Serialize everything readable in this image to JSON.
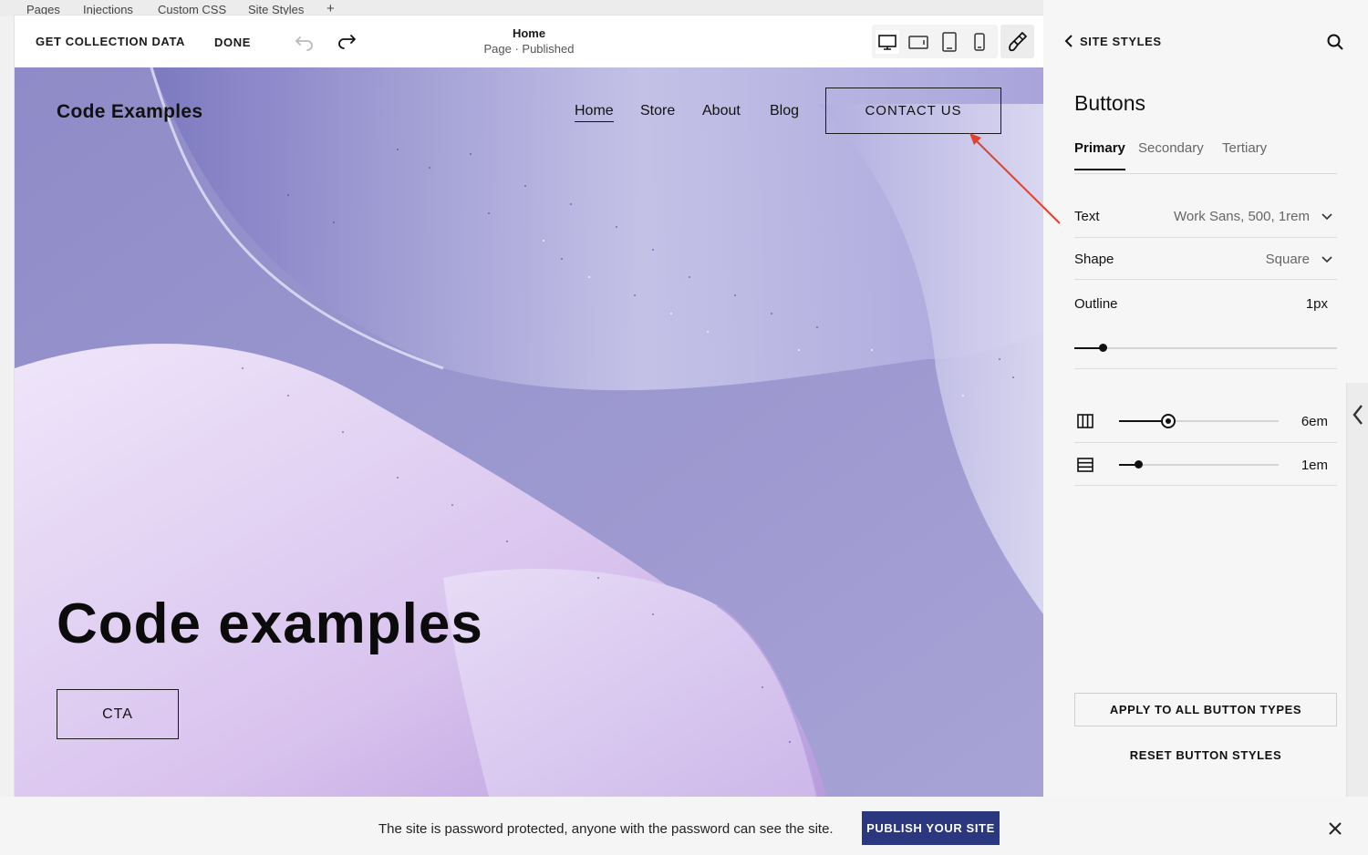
{
  "top_tabs": [
    "Pages",
    "Injections",
    "Custom CSS",
    "Site Styles",
    "+"
  ],
  "toolbar": {
    "get_collection": "GET COLLECTION DATA",
    "done": "DONE",
    "page_name": "Home",
    "page_status": "Page · Published"
  },
  "site": {
    "title": "Code Examples",
    "nav": [
      "Home",
      "Store",
      "About",
      "Blog"
    ],
    "contact": "CONTACT US",
    "hero": "Code examples",
    "cta": "CTA"
  },
  "panel": {
    "back_label": "SITE STYLES",
    "title": "Buttons",
    "tabs": [
      "Primary",
      "Secondary",
      "Tertiary"
    ],
    "text_label": "Text",
    "text_value": "Work Sans, 500, 1rem",
    "shape_label": "Shape",
    "shape_value": "Square",
    "outline_label": "Outline",
    "outline_value": "1px",
    "outline_level": 0.11,
    "width_value": "6em",
    "width_level": 0.31,
    "height_value": "1em",
    "height_level": 0.12,
    "apply_all": "APPLY TO ALL BUTTON TYPES",
    "reset": "RESET BUTTON STYLES"
  },
  "banner": {
    "message": "The site is password protected, anyone with the password can see the site.",
    "publish": "PUBLISH YOUR SITE"
  },
  "colors": {
    "canvas_bg": "#9c98cc",
    "publish_bg": "#2b3880",
    "arrow": "#e2412e"
  }
}
